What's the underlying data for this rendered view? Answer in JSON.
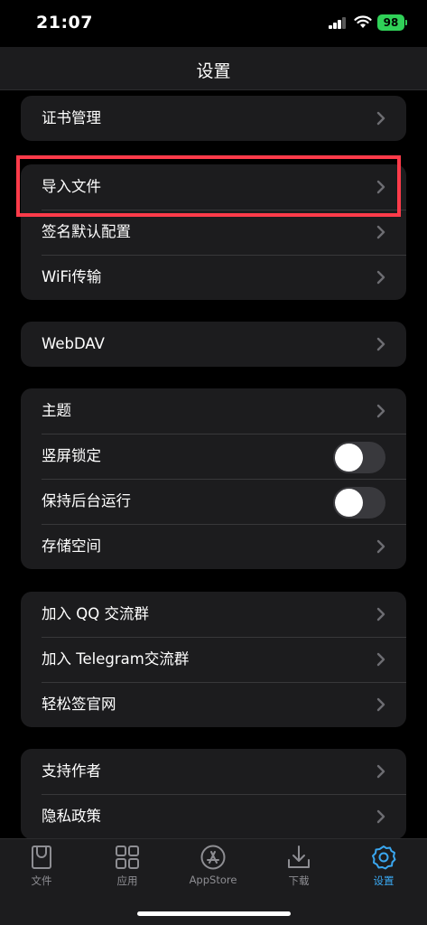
{
  "status_bar": {
    "time": "21:07",
    "battery": "98"
  },
  "nav": {
    "title": "设置"
  },
  "groups": [
    {
      "rows": [
        {
          "label": "证书管理",
          "control": "chevron"
        }
      ]
    },
    {
      "rows": [
        {
          "label": "导入文件",
          "control": "chevron"
        },
        {
          "label": "签名默认配置",
          "control": "chevron"
        },
        {
          "label": "WiFi传输",
          "control": "chevron"
        }
      ]
    },
    {
      "rows": [
        {
          "label": "WebDAV",
          "control": "chevron"
        }
      ]
    },
    {
      "rows": [
        {
          "label": "主题",
          "control": "chevron"
        },
        {
          "label": "竖屏锁定",
          "control": "toggle",
          "toggle_on": false
        },
        {
          "label": "保持后台运行",
          "control": "toggle",
          "toggle_on": false
        },
        {
          "label": "存储空间",
          "control": "chevron"
        }
      ]
    },
    {
      "rows": [
        {
          "label": "加入 QQ 交流群",
          "control": "chevron"
        },
        {
          "label": "加入 Telegram交流群",
          "control": "chevron"
        },
        {
          "label": "轻松签官网",
          "control": "chevron"
        }
      ]
    },
    {
      "rows": [
        {
          "label": "支持作者",
          "control": "chevron"
        },
        {
          "label": "隐私政策",
          "control": "chevron"
        }
      ]
    }
  ],
  "tabs": [
    {
      "label": "文件",
      "icon": "file-icon",
      "active": false
    },
    {
      "label": "应用",
      "icon": "grid-icon",
      "active": false
    },
    {
      "label": "AppStore",
      "icon": "appstore-icon",
      "active": false
    },
    {
      "label": "下载",
      "icon": "download-icon",
      "active": false
    },
    {
      "label": "设置",
      "icon": "gear-icon",
      "active": true
    }
  ],
  "colors": {
    "background": "#000000",
    "card": "#1c1c1e",
    "accent": "#3aa7f0",
    "highlight": "#ff3b4a"
  }
}
